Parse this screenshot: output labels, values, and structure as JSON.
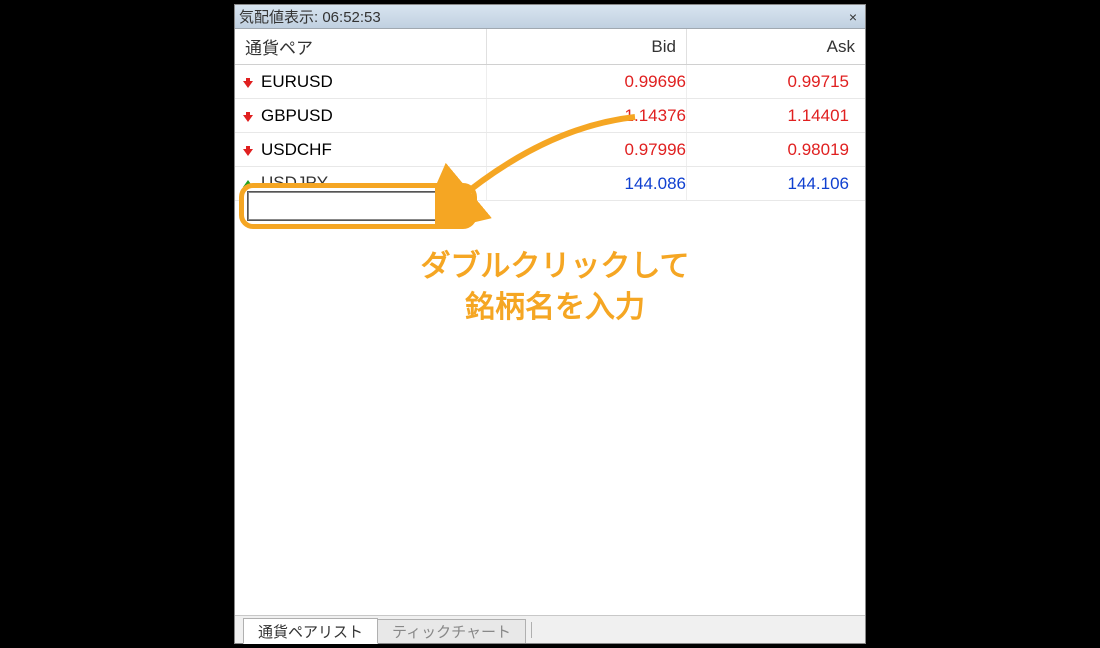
{
  "window": {
    "title_prefix": "気配値表示: ",
    "time": "06:52:53",
    "close_glyph": "×"
  },
  "columns": {
    "symbol": "通貨ペア",
    "bid": "Bid",
    "ask": "Ask"
  },
  "rows": [
    {
      "symbol": "EURUSD",
      "bid": "0.99696",
      "ask": "0.99715",
      "dir": "down"
    },
    {
      "symbol": "GBPUSD",
      "bid": "1.14376",
      "ask": "1.14401",
      "dir": "down"
    },
    {
      "symbol": "USDCHF",
      "bid": "0.97996",
      "ask": "0.98019",
      "dir": "down"
    },
    {
      "symbol": "USDJPY",
      "bid": "144.086",
      "ask": "144.106",
      "dir": "up"
    }
  ],
  "input": {
    "value": ""
  },
  "annotation": {
    "line1": "ダブルクリックして",
    "line2": "銘柄名を入力"
  },
  "tabs": {
    "list": "通貨ペアリスト",
    "tick": "ティックチャート"
  },
  "colors": {
    "accent": "#f5a623",
    "down": "#e02020",
    "up": "#1040d0"
  }
}
